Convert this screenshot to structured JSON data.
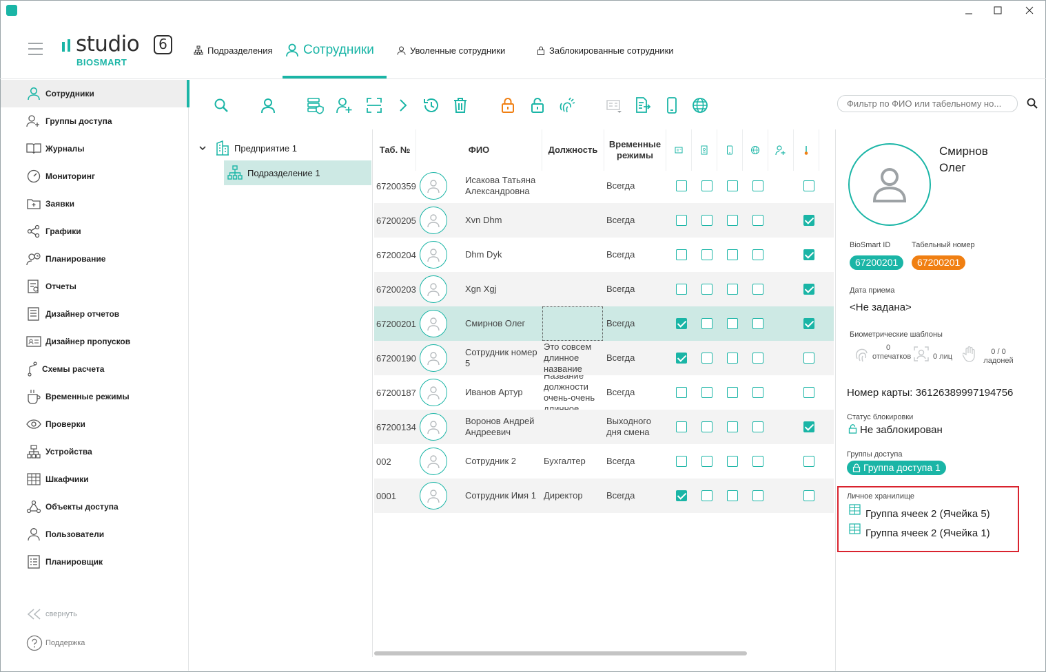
{
  "window": {
    "controls": [
      "minimize",
      "maximize",
      "close"
    ]
  },
  "logo": {
    "word": "studio",
    "version": "6",
    "brand": "BIOSMART"
  },
  "top_tabs": [
    {
      "label": "Подразделения",
      "icon": "org-chart-icon"
    },
    {
      "label": "Сотрудники",
      "icon": "person-icon",
      "active": true
    },
    {
      "label": "Уволенные сотрудники",
      "icon": "person-icon"
    },
    {
      "label": "Заблокированные сотрудники",
      "icon": "lock-icon"
    }
  ],
  "sidebar": {
    "items": [
      {
        "label": "Сотрудники",
        "icon": "person-icon",
        "active": true
      },
      {
        "label": "Группы доступа",
        "icon": "group-icon"
      },
      {
        "label": "Журналы",
        "icon": "book-icon"
      },
      {
        "label": "Мониторинг",
        "icon": "gauge-icon"
      },
      {
        "label": "Заявки",
        "icon": "folder-icon"
      },
      {
        "label": "Графики",
        "icon": "share-icon"
      },
      {
        "label": "Планирование",
        "icon": "person-clock-icon"
      },
      {
        "label": "Отчеты",
        "icon": "report-icon"
      },
      {
        "label": "Дизайнер отчетов",
        "icon": "document-icon"
      },
      {
        "label": "Дизайнер пропусков",
        "icon": "id-card-icon"
      },
      {
        "label": "Схемы расчета",
        "icon": "branch-icon"
      },
      {
        "label": "Временные режимы",
        "icon": "cup-icon"
      },
      {
        "label": "Проверки",
        "icon": "eye-icon"
      },
      {
        "label": "Устройства",
        "icon": "devices-icon"
      },
      {
        "label": "Шкафчики",
        "icon": "lockers-icon"
      },
      {
        "label": "Объекты доступа",
        "icon": "nodes-icon"
      },
      {
        "label": "Пользователи",
        "icon": "user-icon"
      },
      {
        "label": "Планировщик",
        "icon": "list-icon"
      }
    ],
    "collapse_label": "свернуть",
    "support_label": "Поддержка"
  },
  "toolbar": {
    "filter_placeholder": "Фильтр по ФИО или табельному но..."
  },
  "tree": {
    "root": "Предприятие 1",
    "child": "Подразделение 1"
  },
  "table": {
    "headers": {
      "tab": "Таб. №",
      "fio": "ФИО",
      "position": "Должность",
      "modes": "Временные режимы"
    },
    "rows": [
      {
        "tab": "67200359",
        "fio": "Исакова Татьяна Александровна",
        "position": "",
        "mode": "Всегда",
        "c1": false,
        "c2": false,
        "c3": false,
        "c4": false,
        "c6": false
      },
      {
        "tab": "67200205",
        "fio": "Xvn Dhm",
        "position": "",
        "mode": "Всегда",
        "c1": false,
        "c2": false,
        "c3": false,
        "c4": false,
        "c6": true
      },
      {
        "tab": "67200204",
        "fio": "Dhm Dyk",
        "position": "",
        "mode": "Всегда",
        "c1": false,
        "c2": false,
        "c3": false,
        "c4": false,
        "c6": true
      },
      {
        "tab": "67200203",
        "fio": "Xgn Xgj",
        "position": "",
        "mode": "Всегда",
        "c1": false,
        "c2": false,
        "c3": false,
        "c4": false,
        "c6": true
      },
      {
        "tab": "67200201",
        "fio": "Смирнов Олег",
        "position": "",
        "mode": "Всегда",
        "c1": true,
        "c2": false,
        "c3": false,
        "c4": false,
        "c6": true,
        "selected": true
      },
      {
        "tab": "67200190",
        "fio": "Сотрудник номер 5",
        "position": "Это совсем длинное название",
        "mode": "Всегда",
        "c1": true,
        "c2": false,
        "c3": false,
        "c4": false,
        "c6": false
      },
      {
        "tab": "67200187",
        "fio": "Иванов Артур",
        "position": "Название должности очень-очень длинное",
        "mode": "Всегда",
        "c1": false,
        "c2": false,
        "c3": false,
        "c4": false,
        "c6": false
      },
      {
        "tab": "67200134",
        "fio": "Воронов Андрей Андреевич",
        "position": "",
        "mode": "Выходного дня смена",
        "c1": false,
        "c2": false,
        "c3": false,
        "c4": false,
        "c6": true
      },
      {
        "tab": "002",
        "fio": "Сотрудник 2",
        "position": "Бухгалтер",
        "mode": "Всегда",
        "c1": false,
        "c2": false,
        "c3": false,
        "c4": false,
        "c6": false
      },
      {
        "tab": "0001",
        "fio": "Сотрудник Имя 1",
        "position": "Директор",
        "mode": "Всегда",
        "c1": true,
        "c2": false,
        "c3": false,
        "c4": false,
        "c6": false
      }
    ]
  },
  "panel": {
    "name_line1": "Смирнов",
    "name_line2": "Олег",
    "biosmart_id_label": "BioSmart ID",
    "biosmart_id": "67200201",
    "tab_number_label": "Табельный номер",
    "tab_number": "67200201",
    "hire_date_label": "Дата приема",
    "hire_date": "<Не задана>",
    "bio_label": "Биометрические шаблоны",
    "bio_fingerprints": "0 отпечатков",
    "bio_faces": "0 лиц",
    "bio_palms": "0 / 0 ладоней",
    "card_number": "Номер карты: 36126389997194756",
    "block_status_label": "Статус блокировки",
    "block_status": "Не заблокирован",
    "access_groups_label": "Группы доступа",
    "access_group": "Группа доступа 1",
    "storage_label": "Личное хранилище",
    "storage_items": [
      "Группа ячеек 2 (Ячейка 5)",
      "Группа ячеек 2 (Ячейка 1)"
    ]
  },
  "colors": {
    "accent": "#1ab5a6",
    "orange": "#f07f12",
    "selected_row": "#cde9e4",
    "highlight_box": "#d9232e"
  }
}
